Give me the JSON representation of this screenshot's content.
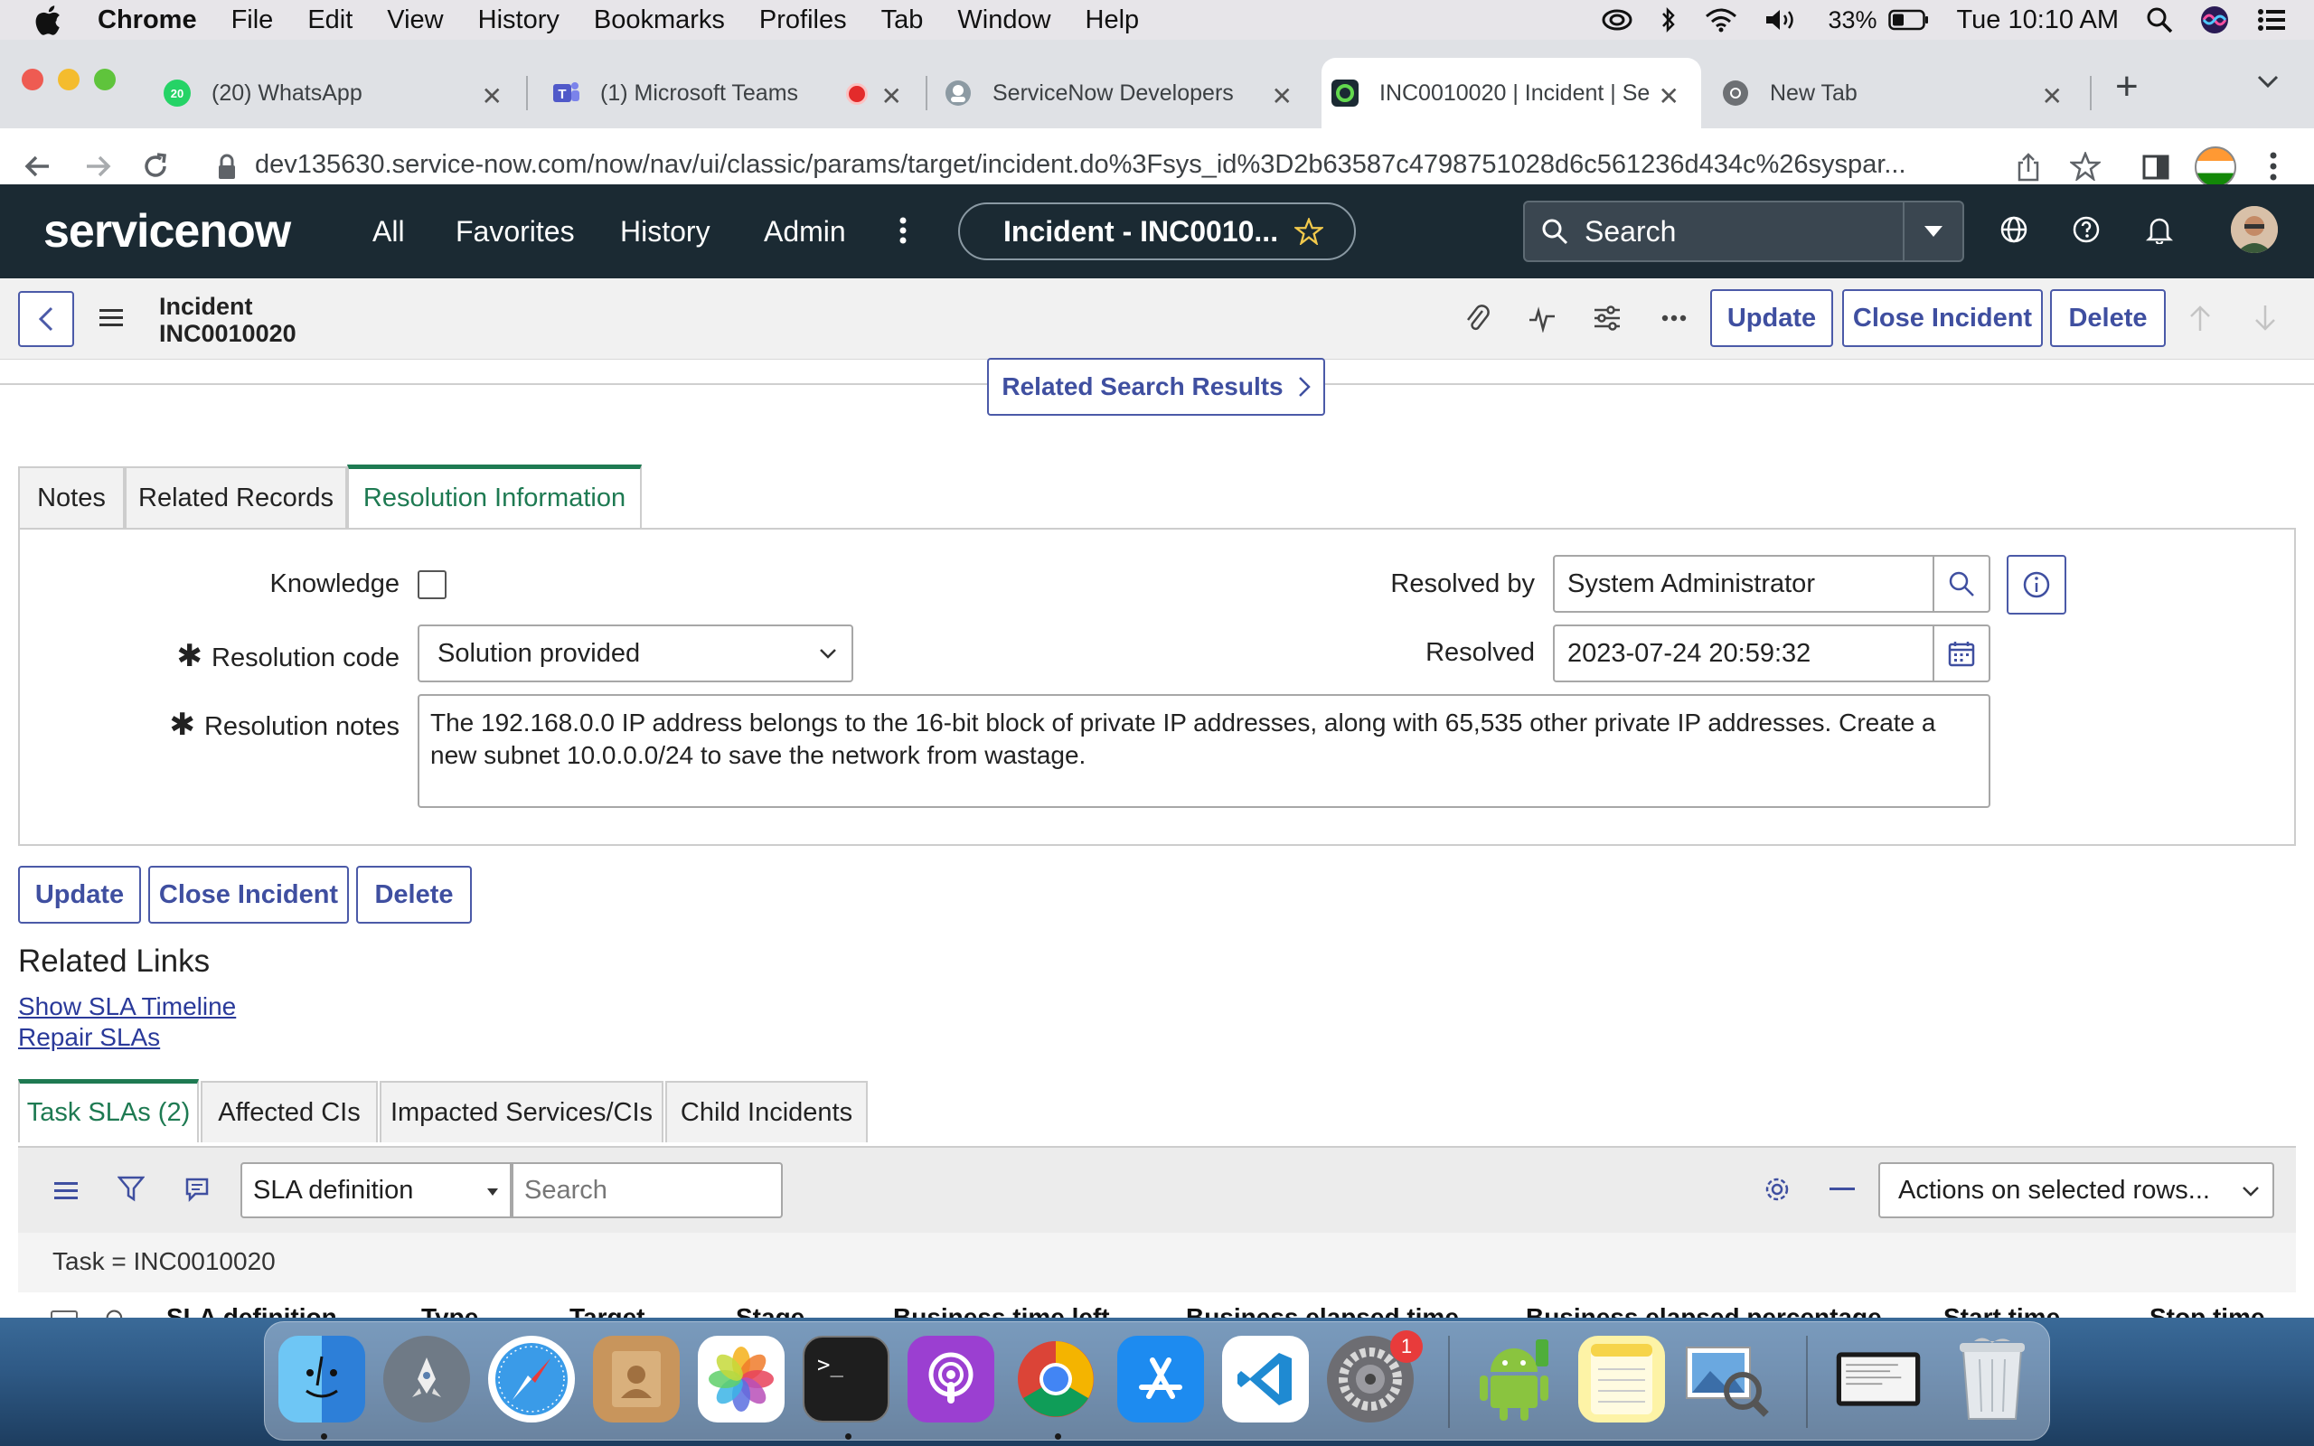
{
  "menubar": {
    "app": "Chrome",
    "items": [
      "File",
      "Edit",
      "View",
      "History",
      "Bookmarks",
      "Profiles",
      "Tab",
      "Window",
      "Help"
    ],
    "battery": "33%",
    "clock": "Tue 10:10 AM"
  },
  "browser": {
    "tabs": [
      {
        "title": "(20) WhatsApp",
        "badge": "20"
      },
      {
        "title": "(1) Microsoft Teams"
      },
      {
        "title": "ServiceNow Developers"
      },
      {
        "title": "INC0010020 | Incident | Se"
      },
      {
        "title": "New Tab"
      }
    ],
    "url": "dev135630.service-now.com/now/nav/ui/classic/params/target/incident.do%3Fsys_id%3D2b63587c4798751028d6c561236d434c%26syspar..."
  },
  "sn_header": {
    "logo": "servicenow",
    "nav": [
      "All",
      "Favorites",
      "History",
      "Admin"
    ],
    "context_pill": "Incident - INC0010...",
    "search_label": "Search"
  },
  "record": {
    "type": "Incident",
    "number": "INC0010020",
    "buttons": {
      "update": "Update",
      "close": "Close Incident",
      "delete": "Delete"
    },
    "related_search": "Related Search Results"
  },
  "form_tabs": [
    "Notes",
    "Related Records",
    "Resolution Information"
  ],
  "resolution": {
    "knowledge_label": "Knowledge",
    "resolution_code_label": "Resolution code",
    "resolution_code_value": "Solution provided",
    "resolution_notes_label": "Resolution notes",
    "resolution_notes_value": "The 192.168.0.0 IP address belongs to the 16-bit block of private IP addresses, along with 65,535 other private IP addresses. Create a new subnet 10.0.0.0/24 to save the network from wastage.",
    "resolved_by_label": "Resolved by",
    "resolved_by_value": "System Administrator",
    "resolved_label": "Resolved",
    "resolved_value": "2023-07-24 20:59:32"
  },
  "related_links": {
    "heading": "Related Links",
    "links": [
      "Show SLA Timeline",
      "Repair SLAs"
    ]
  },
  "list_tabs": [
    "Task SLAs (2)",
    "Affected CIs",
    "Impacted Services/CIs",
    "Child Incidents"
  ],
  "list": {
    "field_select": "SLA definition",
    "search_placeholder": "Search",
    "actions": "Actions on selected rows...",
    "filter": "Task = INC0010020",
    "columns": [
      "SLA definition",
      "Type",
      "Target",
      "Stage",
      "Business time left",
      "Business elapsed time",
      "Business elapsed percentage",
      "Start time",
      "Stop time"
    ]
  },
  "dock": {
    "icons": [
      "finder-icon",
      "launchpad-icon",
      "safari-icon",
      "contacts-icon",
      "photos-icon",
      "terminal-icon",
      "podcasts-icon",
      "chrome-icon",
      "app-store-icon",
      "vscode-icon",
      "system-preferences-icon",
      "android-file-transfer-icon",
      "notes-icon",
      "preview-icon",
      "screenshot-icon",
      "trash-icon"
    ],
    "system_preferences_badge": "1",
    "terminal_glyph": ">_"
  }
}
